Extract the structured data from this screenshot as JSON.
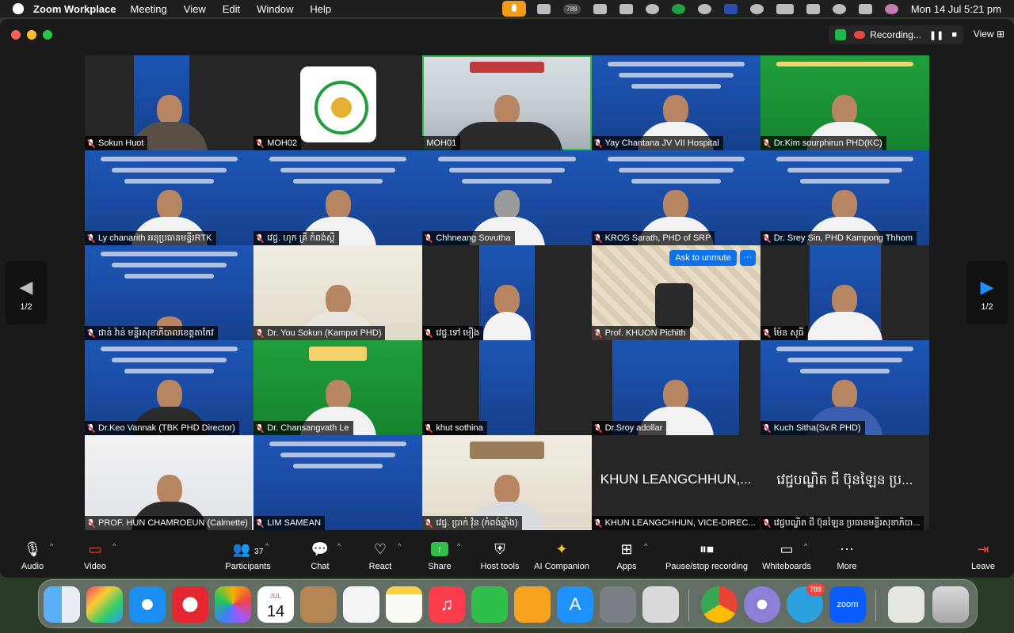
{
  "menubar": {
    "app_name": "Zoom Workplace",
    "menus": [
      "Meeting",
      "View",
      "Edit",
      "Window",
      "Help"
    ],
    "tray_badge": "788",
    "clock": "Mon 14 Jul  5:21 pm"
  },
  "window": {
    "recording_label": "Recording...",
    "view_label": "View"
  },
  "pager": {
    "prev_label": "1/2",
    "next_label": "1/2"
  },
  "tiles": [
    {
      "name": "Sokun Huot"
    },
    {
      "name": "MOH02"
    },
    {
      "name": "MOH01"
    },
    {
      "name": "Yay Chantana JV VII Hospital"
    },
    {
      "name": "Dr.Kim sourphirun PHD(KC)"
    },
    {
      "name": "Ly chanarith អនុប្រធានមន្ទីរRTK"
    },
    {
      "name": "វេជ្ជ. ហុក គ្រី កំពង់ស្ពឺ"
    },
    {
      "name": "Chhneang Sovutha"
    },
    {
      "name": "KROS Sarath, PHD of SRP"
    },
    {
      "name": "Dr. Srey Sin, PHD Kampong Thhom"
    },
    {
      "name": "ផាន់ វ៉ាន់ មន្ទីរសុខាភិបាលខេត្តតាកែវ"
    },
    {
      "name": "Dr. You Sokun (Kampot PHD)"
    },
    {
      "name": "វេជ្ជ.ទៅ មឿង"
    },
    {
      "name": "Prof. KHUON Pichith",
      "ask_to_unmute": "Ask to unmute",
      "more": "···"
    },
    {
      "name": "ម៉ែន សុធី"
    },
    {
      "name": "Dr.Keo Vannak (TBK PHD Director)"
    },
    {
      "name": "Dr. Chansangvath Le"
    },
    {
      "name": "khut sothina"
    },
    {
      "name": "Dr.Sroy adollar"
    },
    {
      "name": "Kuch Sitha(Sv.R PHD)"
    },
    {
      "name": "PROF. HUN CHAMROEUN (Calmette)"
    },
    {
      "name": "LIM SAMEAN"
    },
    {
      "name": "វេជ្ជ. ប្រាក់ វុំន (កំពង់ឆ្នាំង)"
    },
    {
      "name": "KHUN LEANGCHHUN, VICE-DIREC...",
      "big": "KHUN LEANGCHHUN,..."
    },
    {
      "name": "វេជ្ជបណ្ឌិត ជី ប៊ុនឡៃន ប្រធានមន្ទីរសុខាភិបា...",
      "big": "វេជ្ជបណ្ឌិត ជី ប៊ុនឡៃន ប្រ..."
    }
  ],
  "toolbar": {
    "audio": "Audio",
    "video": "Video",
    "participants": "Participants",
    "participants_count": "37",
    "chat": "Chat",
    "react": "React",
    "share": "Share",
    "host_tools": "Host tools",
    "ai_companion": "AI Companion",
    "apps": "Apps",
    "recording": "Pause/stop recording",
    "whiteboards": "Whiteboards",
    "more": "More",
    "leave": "Leave"
  },
  "dock": {
    "calendar_month": "JUL",
    "calendar_day": "14",
    "telegram_badge": "788",
    "zoom_label": "zoom"
  }
}
